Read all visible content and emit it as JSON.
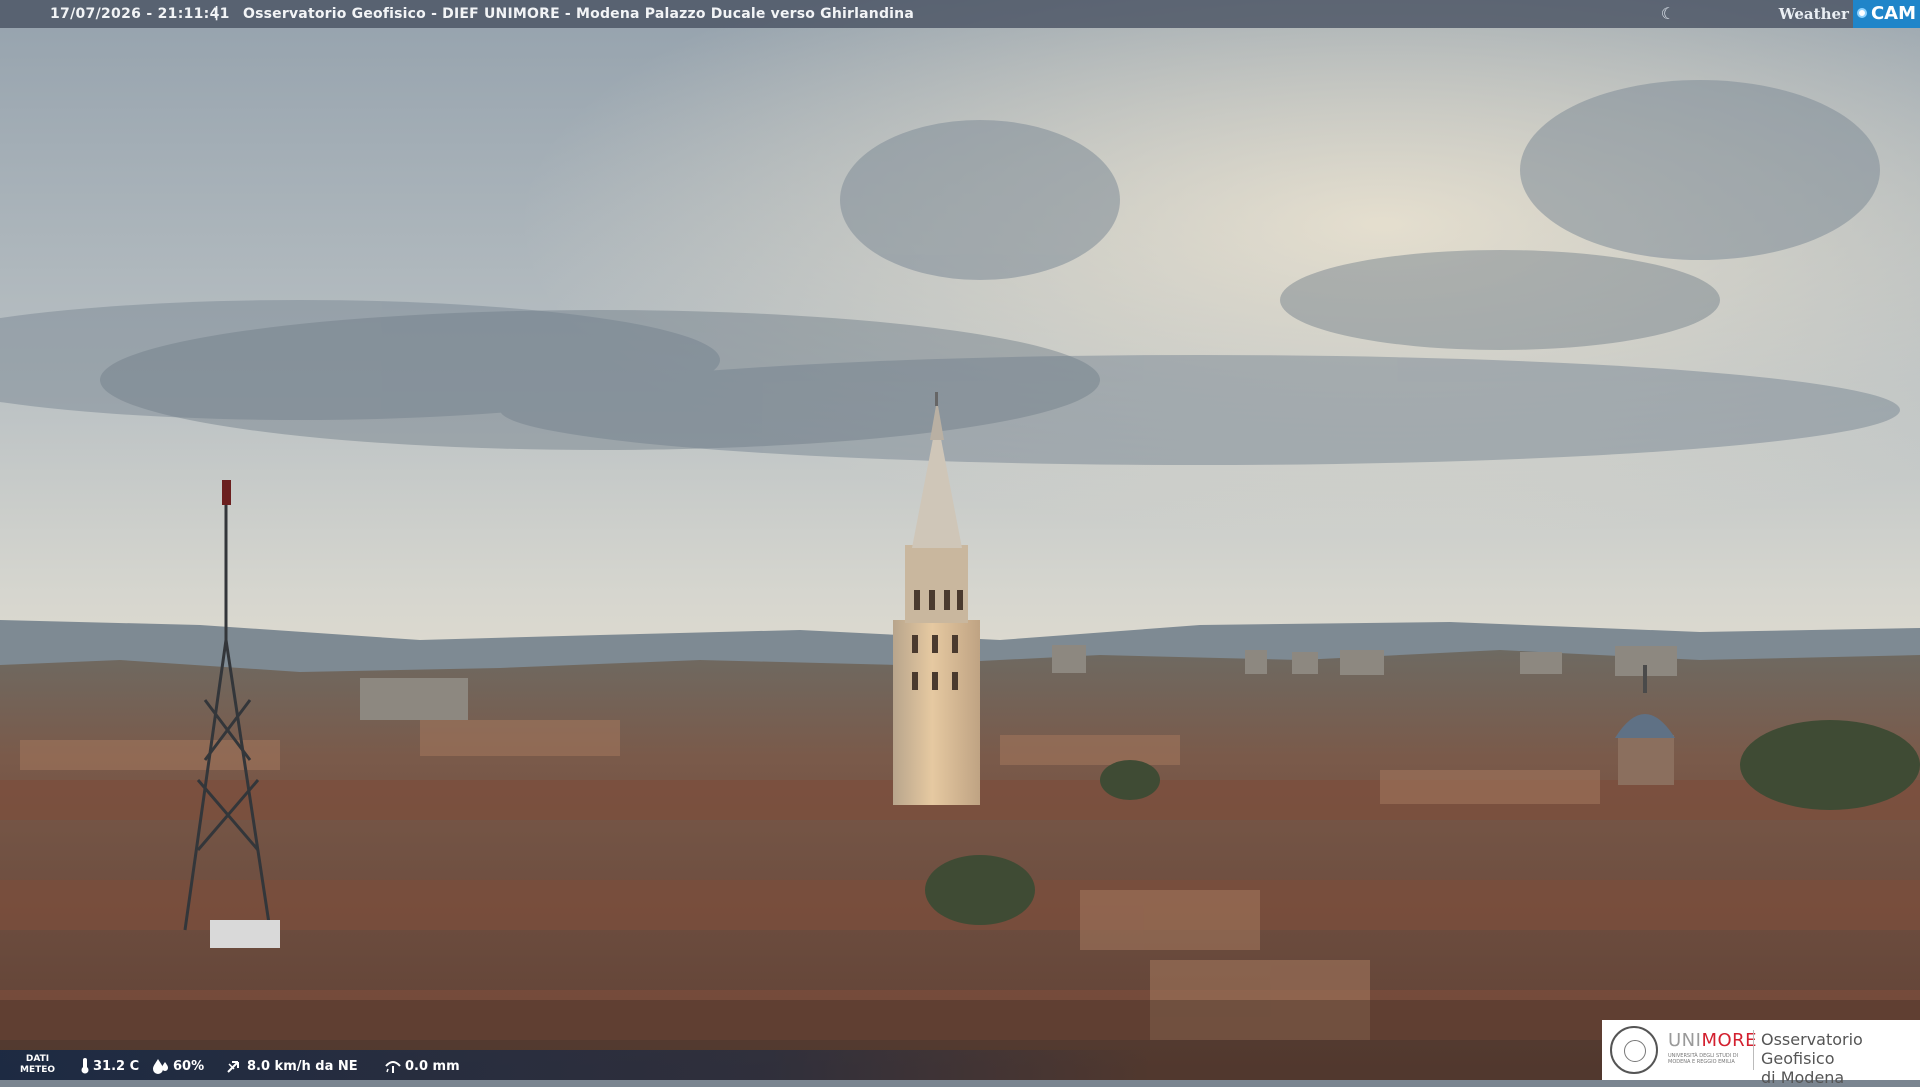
{
  "overlay": {
    "timestamp": "17/07/2026 - 21:11:41",
    "separator": "|",
    "title": "Osservatorio Geofisico - DIEF UNIMORE - Modena Palazzo Ducale verso Ghirlandina"
  },
  "brand": {
    "weather": "Weather",
    "cam": "CAM",
    "accent": "#1f85c9"
  },
  "meteo": {
    "label_line1": "DATI",
    "label_line2": "METEO",
    "temperature": "31.2 C",
    "humidity": "60%",
    "wind": "8.0 km/h da NE",
    "rain": "0.0 mm"
  },
  "logo": {
    "uni_a": "UNI",
    "uni_b": "MORE",
    "uni_sub": "UNIVERSITÀ DEGLI STUDI DI MODENA E REGGIO EMILIA",
    "obs_line1": "Osservatorio Geofisico",
    "obs_line2": "di Modena",
    "red": "#d3202f"
  },
  "scene": {
    "description_icon": "city-skyline-photo",
    "sky_top": "#9fa9b2",
    "sky_mid": "#c8cdcc",
    "horizon": "#dcd6c8",
    "roof_color": "#8a5a48"
  }
}
